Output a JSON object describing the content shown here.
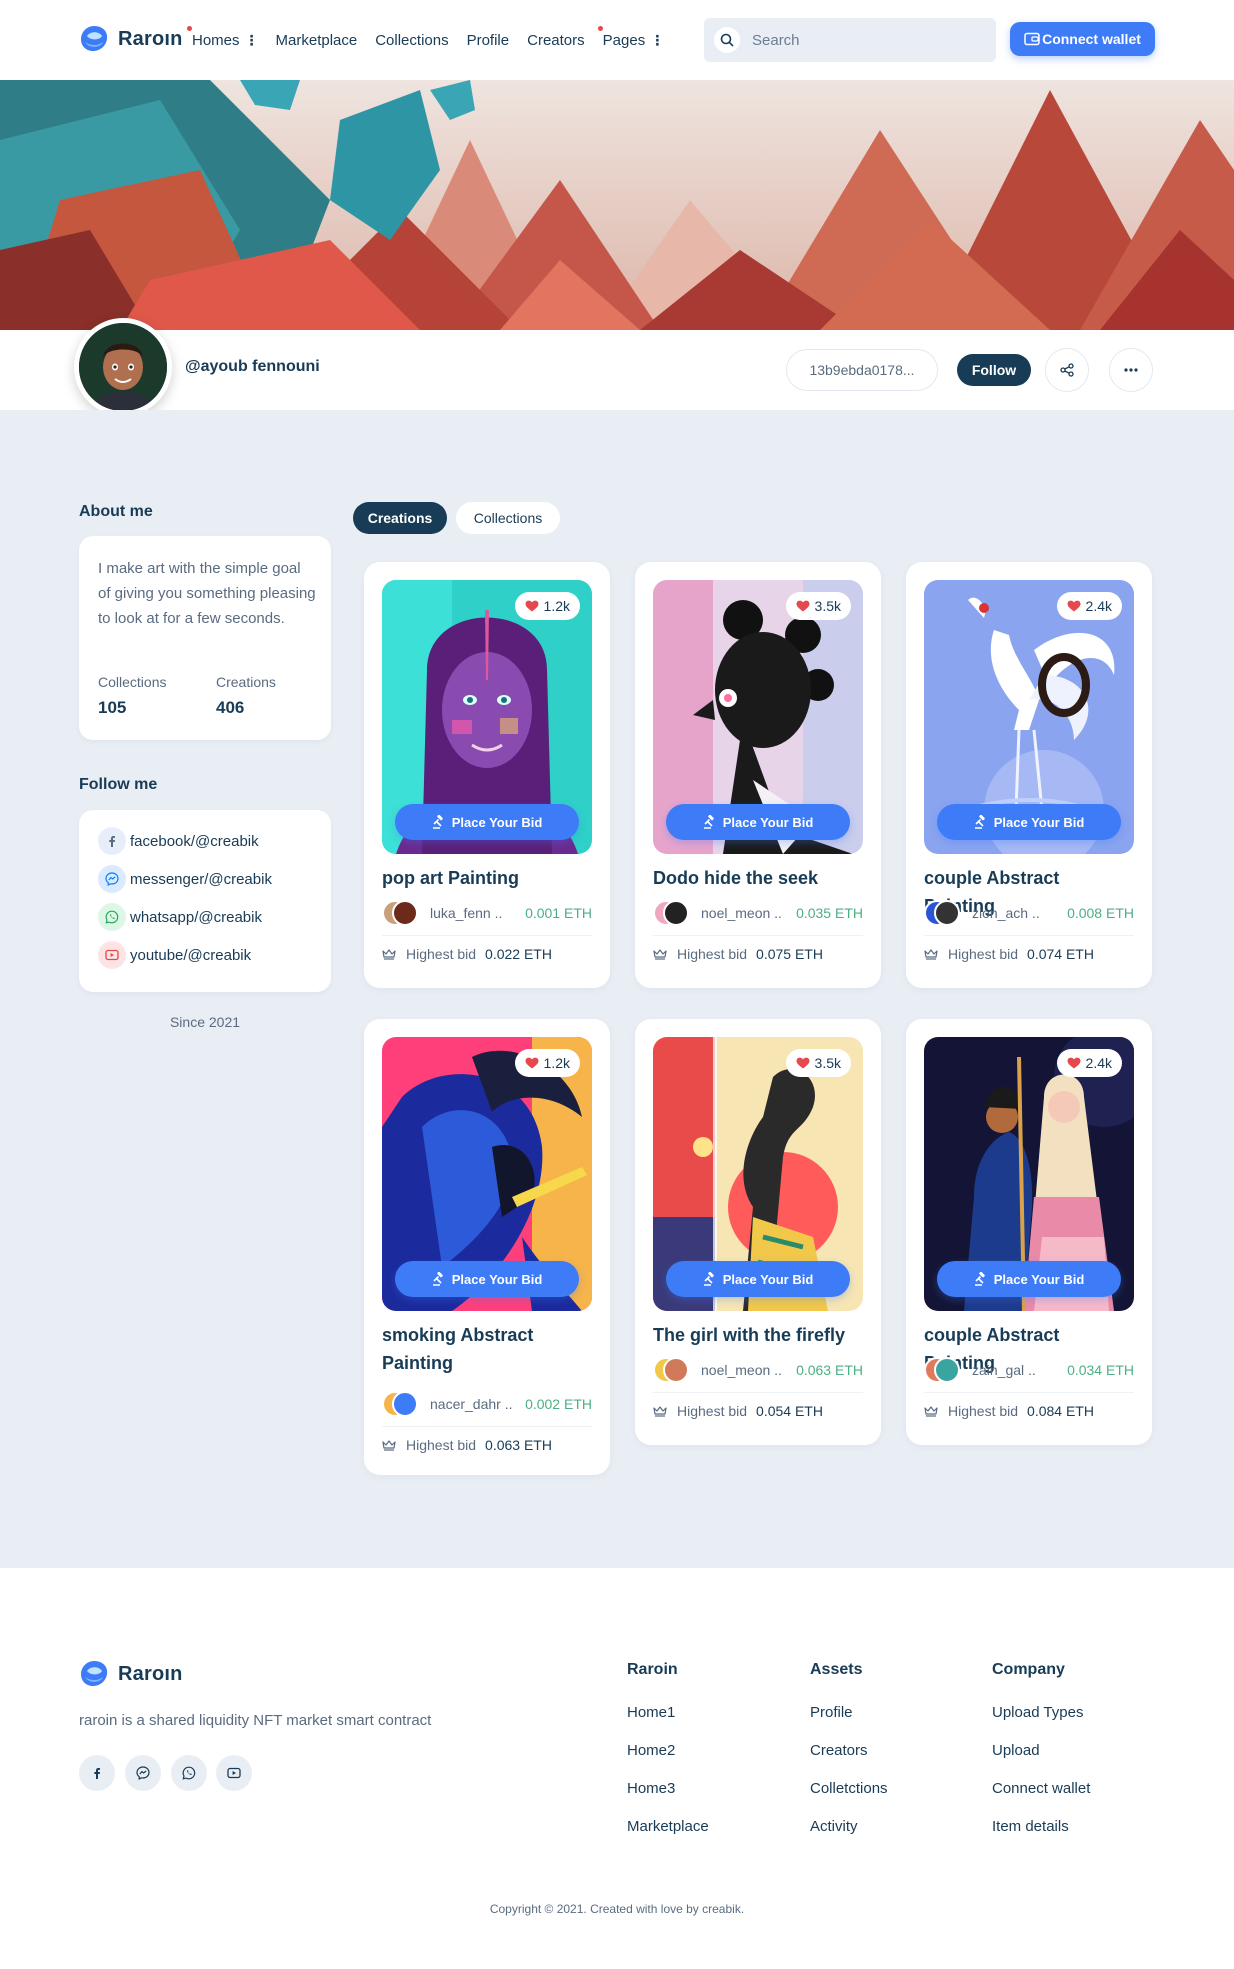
{
  "brand": {
    "name": "Raroın"
  },
  "nav": {
    "items": [
      {
        "label": "Homes",
        "has_menu": true,
        "has_dot": true
      },
      {
        "label": "Marketplace"
      },
      {
        "label": "Collections"
      },
      {
        "label": "Profile"
      },
      {
        "label": "Creators"
      },
      {
        "label": "Pages",
        "has_menu": true,
        "has_dot": true
      }
    ],
    "search_placeholder": "Search",
    "connect_label": "Connect wallet"
  },
  "profile": {
    "username": "@ayoub fennouni",
    "wallet": "13b9ebda0178...",
    "follow_label": "Follow"
  },
  "sidebar": {
    "about_title": "About me",
    "about_text": "I make art with the simple goal of giving you something pleasing to look at for a few seconds.",
    "stats": [
      {
        "label": "Collections",
        "value": "105"
      },
      {
        "label": "Creations",
        "value": "406"
      }
    ],
    "follow_title": "Follow me",
    "socials": [
      {
        "icon": "facebook-icon",
        "label": "facebook/@creabik",
        "color": "#3b5998"
      },
      {
        "icon": "messenger-icon",
        "label": "messenger/@creabik",
        "color": "#0084ff"
      },
      {
        "icon": "whatsapp-icon",
        "label": "whatsapp/@creabik",
        "color": "#25d366"
      },
      {
        "icon": "youtube-icon",
        "label": "youtube/@creabik",
        "color": "#ff0000"
      }
    ],
    "since": "Since 2021"
  },
  "tabs": [
    "Creations",
    "Collections"
  ],
  "cards": [
    {
      "title": "pop art Painting",
      "likes": "1.2k",
      "owner": "luka_fenn ..",
      "price": "0.001 ETH",
      "bid_label": "Highest bid",
      "bid": "0.022 ETH",
      "button": "Place Your Bid"
    },
    {
      "title": "Dodo hide the seek",
      "likes": "3.5k",
      "owner": "noel_meon ..",
      "price": "0.035 ETH",
      "bid_label": "Highest bid",
      "bid": "0.075 ETH",
      "button": "Place Your Bid"
    },
    {
      "title": "couple Abstract Painting",
      "likes": "2.4k",
      "owner": "zion_ach ..",
      "price": "0.008 ETH",
      "bid_label": "Highest bid",
      "bid": "0.074 ETH",
      "button": "Place Your Bid"
    },
    {
      "title": "smoking Abstract Painting",
      "likes": "1.2k",
      "owner": "nacer_dahr ..",
      "price": "0.002 ETH",
      "bid_label": "Highest bid",
      "bid": "0.063 ETH",
      "button": "Place Your Bid"
    },
    {
      "title": "The girl with the firefly",
      "likes": "3.5k",
      "owner": "noel_meon ..",
      "price": "0.063 ETH",
      "bid_label": "Highest bid",
      "bid": "0.054 ETH",
      "button": "Place Your Bid"
    },
    {
      "title": "couple Abstract Painting",
      "likes": "2.4k",
      "owner": "zain_gal ..",
      "price": "0.034 ETH",
      "bid_label": "Highest bid",
      "bid": "0.084 ETH",
      "button": "Place Your Bid"
    }
  ],
  "footer": {
    "description": "raroin is a shared liquidity NFT market smart contract",
    "columns": [
      {
        "title": "Raroin",
        "links": [
          "Home1",
          "Home2",
          "Home3",
          "Marketplace"
        ]
      },
      {
        "title": "Assets",
        "links": [
          "Profile",
          "Creators",
          "Colletctions",
          "Activity"
        ]
      },
      {
        "title": "Company",
        "links": [
          "Upload Types",
          "Upload",
          "Connect wallet",
          "Item details"
        ]
      }
    ],
    "copyright": "Copyright © 2021. Created with love by creabik."
  },
  "colors": {
    "primary": "#3d7bf7",
    "dark": "#183b56",
    "price_green": "#4caf84",
    "bg": "#e9eef5"
  }
}
